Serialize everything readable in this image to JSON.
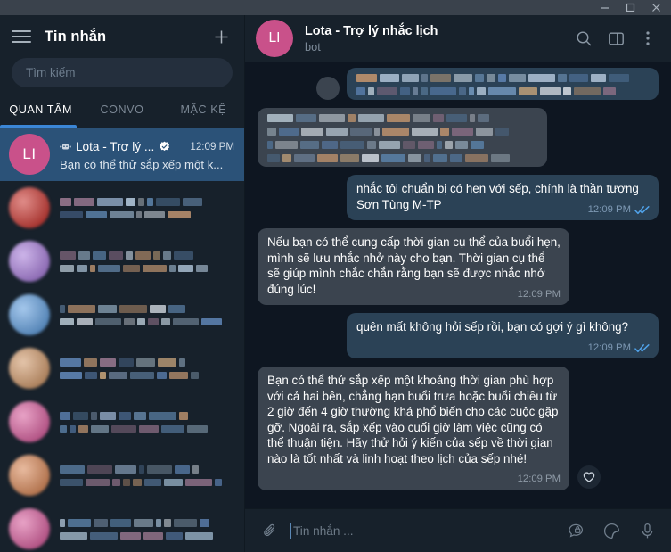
{
  "window": {
    "minimize_label": "—",
    "maximize_label": "□",
    "close_label": "✕"
  },
  "sidebar": {
    "menu_icon": "hamburger-icon",
    "title": "Tin nhắn",
    "add_icon": "plus-icon",
    "search": {
      "placeholder": "Tìm kiếm",
      "value": ""
    },
    "tabs": [
      {
        "label": "QUAN TÂM",
        "active": true
      },
      {
        "label": "CONVO",
        "active": false
      },
      {
        "label": "MẶC KỆ",
        "active": false
      }
    ],
    "chats": [
      {
        "avatar_initials": "LI",
        "avatar_color": "#c9518a",
        "name": "Lota - Trợ lý ...",
        "is_bot": true,
        "verified": true,
        "time": "12:09 PM",
        "preview": "Bạn có thể thử sắp xếp một k...",
        "selected": true,
        "censored": false
      },
      {
        "avatar_color": "#c21b14",
        "censored": true,
        "selected": false
      },
      {
        "avatar_color": "#9b6ad4",
        "censored": true,
        "selected": false
      },
      {
        "avatar_color": "#4a90d9",
        "censored": true,
        "selected": false
      },
      {
        "avatar_color": "#c98a55",
        "censored": true,
        "selected": false
      },
      {
        "avatar_color": "#d2478f",
        "censored": true,
        "selected": false
      },
      {
        "avatar_color": "#d2763f",
        "censored": true,
        "selected": false
      },
      {
        "avatar_color": "#d2478f",
        "censored": true,
        "selected": false
      }
    ]
  },
  "chat_header": {
    "avatar_initials": "LI",
    "avatar_color": "#c9518a",
    "title": "Lota - Trợ lý nhắc lịch",
    "subtitle": "bot",
    "search_icon": "search-icon",
    "panel_icon": "panel-toggle-icon",
    "menu_icon": "more-vertical-icon"
  },
  "messages": [
    {
      "id": "m1",
      "direction": "out",
      "censored": true,
      "text": "",
      "time": "",
      "ticks": false
    },
    {
      "id": "m2",
      "direction": "in",
      "censored": true,
      "text": "",
      "time": "",
      "ticks": false
    },
    {
      "id": "m3",
      "direction": "out",
      "censored": false,
      "text": "nhắc tôi chuẩn bị có hẹn với sếp, chính là thần tượng Sơn Tùng M-TP",
      "time": "12:09 PM",
      "ticks": true
    },
    {
      "id": "m4",
      "direction": "in",
      "censored": false,
      "text": "Nếu bạn có thể cung cấp thời gian cụ thể của buổi hẹn, mình sẽ lưu nhắc nhở này cho bạn. Thời gian cụ thể sẽ giúp mình chắc chắn rằng bạn sẽ được nhắc nhở đúng lúc!",
      "time": "12:09 PM",
      "ticks": false
    },
    {
      "id": "m5",
      "direction": "out",
      "censored": false,
      "text": "quên mất không hỏi sếp rồi, bạn có gợi ý gì không?",
      "time": "12:09 PM",
      "ticks": true
    },
    {
      "id": "m6",
      "direction": "in",
      "censored": false,
      "text": "Bạn có thể thử sắp xếp một khoảng thời gian phù hợp với cả hai bên, chẳng hạn buổi trưa hoặc buổi chiều từ 2 giờ đến 4 giờ thường khá phổ biến cho các cuộc gặp gỡ. Ngoài ra, sắp xếp vào cuối giờ làm việc cũng có thể thuận tiện. Hãy thử hỏi ý kiến của sếp về thời gian nào là tốt nhất và linh hoạt theo lịch của sếp nhé!",
      "time": "12:09 PM",
      "ticks": false,
      "reaction_icon": "heart-icon"
    }
  ],
  "composer": {
    "attach_icon": "paperclip-icon",
    "placeholder": "Tin nhắn ...",
    "value": "",
    "secret_icon": "secret-chat-icon",
    "sticker_icon": "sticker-icon",
    "mic_icon": "microphone-icon"
  },
  "colors": {
    "accent": "#3b86d6",
    "bubble_out": "#2b4256",
    "bubble_in": "#3b444f",
    "selected_row": "#2b5278",
    "sidebar_bg": "#17212b",
    "chat_bg": "#0e1621",
    "tick_blue": "#50a2e9"
  }
}
